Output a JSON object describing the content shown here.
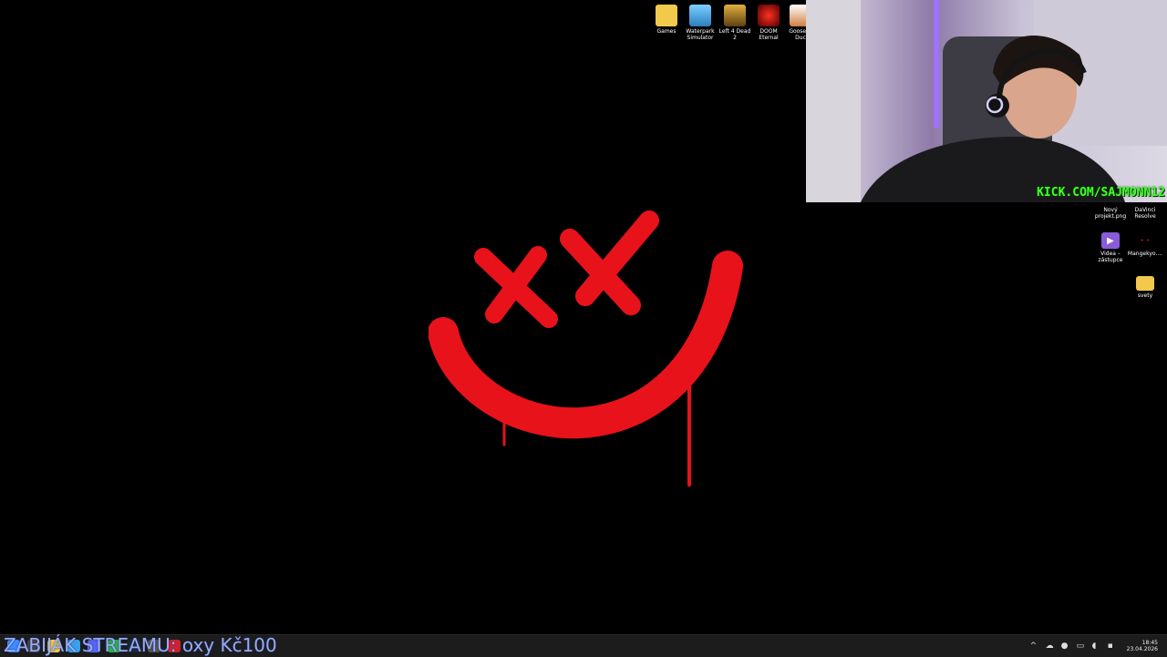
{
  "desktop": {
    "top_icons": [
      {
        "label": "Games",
        "icon": "folder-icon",
        "color": "#f2c94c"
      },
      {
        "label": "Waterpark\nSimulator",
        "icon": "game-icon",
        "color": "#3aa0e8"
      },
      {
        "label": "Left 4 Dead 2",
        "icon": "game-icon",
        "color": "#b08020"
      },
      {
        "label": "DOOM\nEternal",
        "icon": "game-icon",
        "color": "#c0201a"
      },
      {
        "label": "Goose G\nDuc",
        "icon": "game-icon",
        "color": "#d08040"
      }
    ],
    "right_icons": [
      {
        "label": "Nový\nprojekt.png",
        "icon": "image-file-icon",
        "color": "#222222"
      },
      {
        "label": "DaVinci\nResolve",
        "icon": "app-icon",
        "color": "#222222"
      },
      {
        "label": "Videa –\nzástupce",
        "icon": "video-folder-icon",
        "color": "#8a5cd8"
      },
      {
        "label": "Mangekyo....",
        "icon": "image-file-icon",
        "color": "#111111"
      },
      {
        "label": "svety",
        "icon": "folder-icon",
        "color": "#f2c94c"
      }
    ]
  },
  "webcam": {
    "banner": "KICK.COM/SAJMONN12"
  },
  "taskbar": {
    "stream_banner": "ZABIJÁK STREAMU: oxy Kč100",
    "clock_time": "18:45",
    "clock_date": "23.04.2026"
  },
  "colors": {
    "logo_red": "#e8121b",
    "kick_green": "#41ff2a",
    "taskbar": "#1c1c1c"
  }
}
